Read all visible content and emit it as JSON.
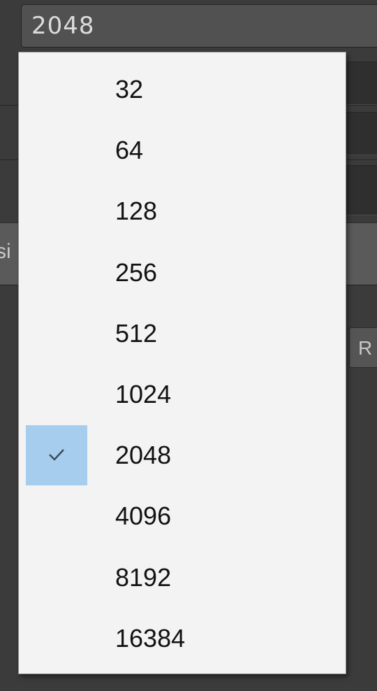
{
  "background": {
    "side_label": "si",
    "button_label": "R"
  },
  "combo": {
    "selected_value": "2048"
  },
  "dropdown": {
    "options": [
      {
        "label": "32",
        "selected": false
      },
      {
        "label": "64",
        "selected": false
      },
      {
        "label": "128",
        "selected": false
      },
      {
        "label": "256",
        "selected": false
      },
      {
        "label": "512",
        "selected": false
      },
      {
        "label": "1024",
        "selected": false
      },
      {
        "label": "2048",
        "selected": true
      },
      {
        "label": "4096",
        "selected": false
      },
      {
        "label": "8192",
        "selected": false
      },
      {
        "label": "16384",
        "selected": false
      }
    ],
    "check_icon": "checkmark-icon",
    "selection_color": "#a6cdee"
  }
}
